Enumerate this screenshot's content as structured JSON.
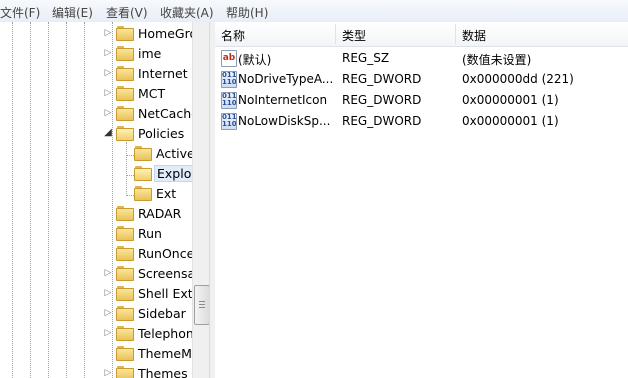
{
  "menu": {
    "items": [
      "文件(F)",
      "编辑(E)",
      "查看(V)",
      "收藏夹(A)",
      "帮助(H)"
    ]
  },
  "tree": {
    "nodes": [
      {
        "label": "HomeGro",
        "arrow": "collapsed",
        "level": 1
      },
      {
        "label": "ime",
        "arrow": "collapsed",
        "level": 1
      },
      {
        "label": "Internet S",
        "arrow": "collapsed",
        "level": 1
      },
      {
        "label": "MCT",
        "arrow": "collapsed",
        "level": 1
      },
      {
        "label": "NetCache",
        "arrow": "collapsed",
        "level": 1
      },
      {
        "label": "Policies",
        "arrow": "expanded",
        "level": 1
      },
      {
        "label": "Active",
        "arrow": "none",
        "level": 2
      },
      {
        "label": "Explor",
        "arrow": "none",
        "level": 2,
        "selected": true
      },
      {
        "label": "Ext",
        "arrow": "none",
        "level": 2
      },
      {
        "label": "RADAR",
        "arrow": "none",
        "level": 1
      },
      {
        "label": "Run",
        "arrow": "none",
        "level": 1
      },
      {
        "label": "RunOnce",
        "arrow": "none",
        "level": 1
      },
      {
        "label": "Screensa",
        "arrow": "collapsed",
        "level": 1
      },
      {
        "label": "Shell Exte",
        "arrow": "collapsed",
        "level": 1
      },
      {
        "label": "Sidebar",
        "arrow": "collapsed",
        "level": 1
      },
      {
        "label": "Telephon",
        "arrow": "collapsed",
        "level": 1
      },
      {
        "label": "ThemeMa",
        "arrow": "none",
        "level": 1
      },
      {
        "label": "Themes",
        "arrow": "collapsed",
        "level": 1
      }
    ]
  },
  "list": {
    "columns": [
      "名称",
      "类型",
      "数据"
    ],
    "rows": [
      {
        "icon": "string-value-icon",
        "name": "(默认)",
        "type": "REG_SZ",
        "data": "(数值未设置)"
      },
      {
        "icon": "dword-value-icon",
        "name": "NoDriveTypeA...",
        "type": "REG_DWORD",
        "data": "0x000000dd (221)"
      },
      {
        "icon": "dword-value-icon",
        "name": "NoInternetIcon",
        "type": "REG_DWORD",
        "data": "0x00000001 (1)"
      },
      {
        "icon": "dword-value-icon",
        "name": "NoLowDiskSp...",
        "type": "REG_DWORD",
        "data": "0x00000001 (1)"
      }
    ]
  },
  "icons": {
    "string_glyph": "ab",
    "dword_glyph": "011\n110"
  },
  "colors": {
    "selection": "#e1ecfb",
    "folder": "#f0cf6c"
  }
}
